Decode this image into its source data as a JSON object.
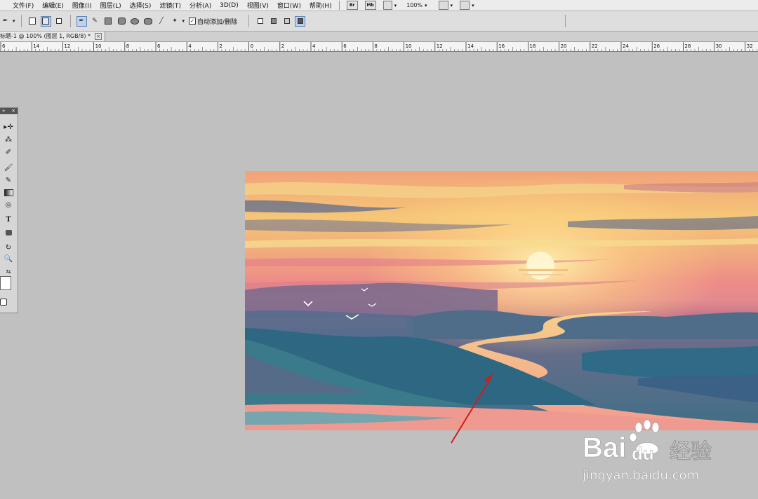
{
  "menubar": {
    "items": [
      "文件(F)",
      "编辑(E)",
      "图像(I)",
      "图层(L)",
      "选择(S)",
      "滤镜(T)",
      "分析(A)",
      "3D(D)",
      "视图(V)",
      "窗口(W)",
      "帮助(H)"
    ],
    "btn_br": "Br",
    "btn_mb": "Mb",
    "zoom": "100%"
  },
  "options": {
    "auto_add_delete_label": "自动添加/删除",
    "auto_add_delete_checked": true
  },
  "document_tab": {
    "title": "标题-1 @ 100% (图层 1, RGB/8) *",
    "close": "×"
  },
  "ruler": {
    "labels": [
      "6",
      "14",
      "12",
      "10",
      "8",
      "6",
      "4",
      "2",
      "0",
      "2",
      "4",
      "6",
      "8",
      "10",
      "12",
      "14",
      "16",
      "18",
      "20",
      "22",
      "24",
      "26",
      "28",
      "30",
      "32"
    ]
  },
  "toolbox": {
    "tools": [
      "move-tool",
      "magic-wand-tool",
      "eyedropper-tool",
      "brush-tool",
      "history-brush-tool",
      "gradient-tool",
      "dodge-tool",
      "pen-tool",
      "type-tool",
      "shape-tool",
      "3d-rotate-tool",
      "zoom-tool",
      "swap-colors",
      "foreground-color",
      "quick-mask"
    ],
    "type_tool_glyph": "T"
  },
  "canvas": {
    "description_id": "sunset-river-painting"
  },
  "watermark": {
    "brand": "Bai",
    "brand_suffix": "经验",
    "url": "jingyan.baidu.com"
  },
  "colors": {
    "annotation_arrow": "#cc1f1f",
    "workspace": "#c0c0c0"
  }
}
